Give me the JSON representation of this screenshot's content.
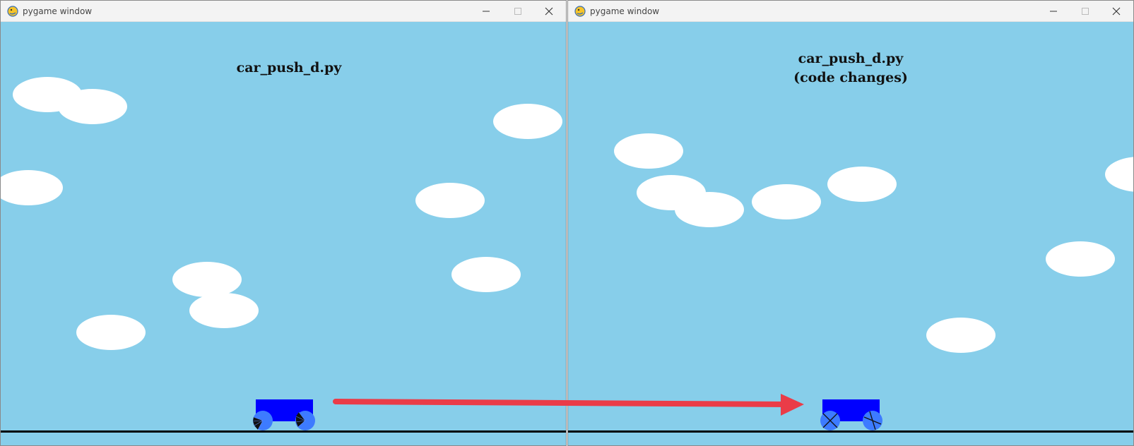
{
  "windows": [
    {
      "title": "pygame window",
      "caption_lines": [
        "car_push_d.py"
      ],
      "wheel_style": "spoked-fan",
      "controls": [
        "minimize-icon",
        "maximize-icon",
        "close-icon"
      ]
    },
    {
      "title": "pygame window",
      "caption_lines": [
        "car_push_d.py",
        "(code changes)"
      ],
      "wheel_style": "x-cross",
      "controls": [
        "minimize-icon",
        "maximize-icon",
        "close-icon"
      ]
    }
  ],
  "overlay": {
    "arrow_icon": "right-arrow-icon",
    "arrow_color": "#ea3c48"
  },
  "colors": {
    "sky": "#87ceea",
    "cloud": "#ffffff",
    "car_body": "#0000ff",
    "wheel": "#3d7bff",
    "ground": "#000000",
    "titlebar": "#f3f3f3"
  }
}
